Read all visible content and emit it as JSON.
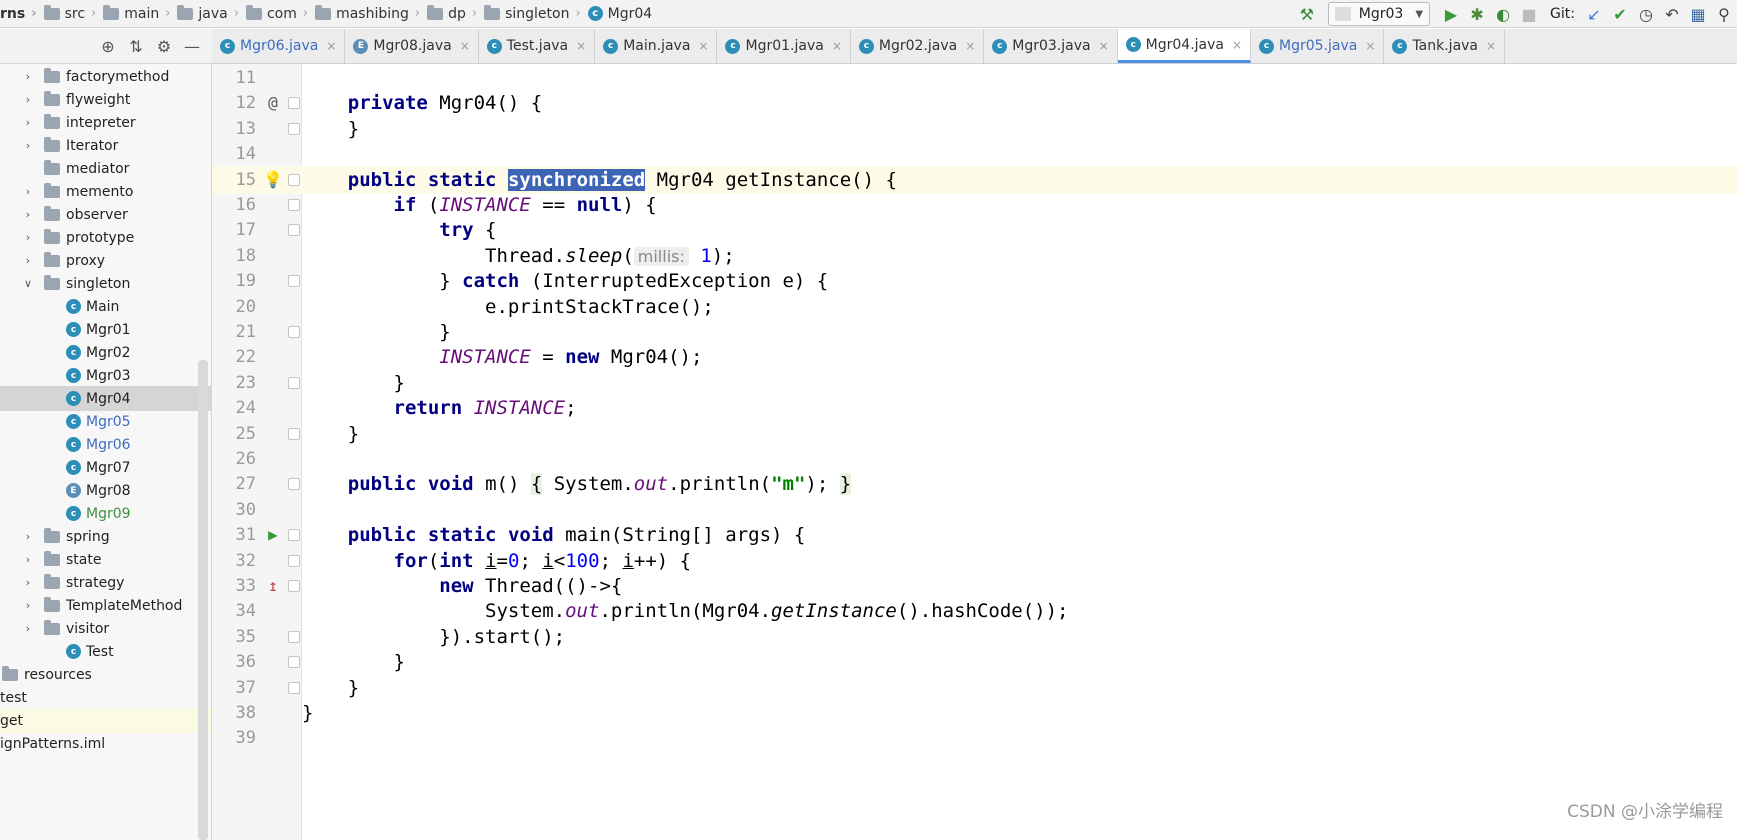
{
  "breadcrumbs": [
    "rns",
    "src",
    "main",
    "java",
    "com",
    "mashibing",
    "dp",
    "singleton",
    "Mgr04"
  ],
  "run_config": "Mgr03",
  "git_label": "Git:",
  "tabs": [
    {
      "label": "Mgr06.java",
      "modified": true,
      "active": false,
      "kind": "class"
    },
    {
      "label": "Mgr08.java",
      "modified": false,
      "active": false,
      "kind": "enum"
    },
    {
      "label": "Test.java",
      "modified": false,
      "active": false,
      "kind": "class"
    },
    {
      "label": "Main.java",
      "modified": false,
      "active": false,
      "kind": "class"
    },
    {
      "label": "Mgr01.java",
      "modified": false,
      "active": false,
      "kind": "class"
    },
    {
      "label": "Mgr02.java",
      "modified": false,
      "active": false,
      "kind": "class"
    },
    {
      "label": "Mgr03.java",
      "modified": false,
      "active": false,
      "kind": "class"
    },
    {
      "label": "Mgr04.java",
      "modified": false,
      "active": true,
      "kind": "class"
    },
    {
      "label": "Mgr05.java",
      "modified": true,
      "active": false,
      "kind": "class"
    },
    {
      "label": "Tank.java",
      "modified": false,
      "active": false,
      "kind": "class"
    }
  ],
  "tree": [
    {
      "label": "factorymethod",
      "type": "pkg",
      "expand": "closed",
      "indent": 1
    },
    {
      "label": "flyweight",
      "type": "pkg",
      "expand": "closed",
      "indent": 1
    },
    {
      "label": "intepreter",
      "type": "pkg",
      "expand": "closed",
      "indent": 1
    },
    {
      "label": "Iterator",
      "type": "pkg",
      "expand": "closed",
      "indent": 1
    },
    {
      "label": "mediator",
      "type": "pkg",
      "expand": "none",
      "indent": 1
    },
    {
      "label": "memento",
      "type": "pkg",
      "expand": "closed",
      "indent": 1
    },
    {
      "label": "observer",
      "type": "pkg",
      "expand": "closed",
      "indent": 1
    },
    {
      "label": "prototype",
      "type": "pkg",
      "expand": "closed",
      "indent": 1
    },
    {
      "label": "proxy",
      "type": "pkg",
      "expand": "closed",
      "indent": 1
    },
    {
      "label": "singleton",
      "type": "pkg",
      "expand": "open",
      "indent": 1
    },
    {
      "label": "Main",
      "type": "class",
      "indent": 2
    },
    {
      "label": "Mgr01",
      "type": "class",
      "indent": 2
    },
    {
      "label": "Mgr02",
      "type": "class",
      "indent": 2
    },
    {
      "label": "Mgr03",
      "type": "class",
      "indent": 2
    },
    {
      "label": "Mgr04",
      "type": "class",
      "indent": 2,
      "selected": true
    },
    {
      "label": "Mgr05",
      "type": "class",
      "indent": 2,
      "color": "blue"
    },
    {
      "label": "Mgr06",
      "type": "class",
      "indent": 2,
      "color": "blue"
    },
    {
      "label": "Mgr07",
      "type": "class",
      "indent": 2
    },
    {
      "label": "Mgr08",
      "type": "enum",
      "indent": 2
    },
    {
      "label": "Mgr09",
      "type": "class",
      "indent": 2,
      "color": "green"
    },
    {
      "label": "spring",
      "type": "pkg",
      "expand": "closed",
      "indent": 1
    },
    {
      "label": "state",
      "type": "pkg",
      "expand": "closed",
      "indent": 1
    },
    {
      "label": "strategy",
      "type": "pkg",
      "expand": "closed",
      "indent": 1
    },
    {
      "label": "TemplateMethod",
      "type": "pkg",
      "expand": "closed",
      "indent": 1
    },
    {
      "label": "visitor",
      "type": "pkg",
      "expand": "closed",
      "indent": 1
    },
    {
      "label": "Test",
      "type": "class",
      "indent": 2
    },
    {
      "label": "resources",
      "type": "pkg",
      "expand": "none",
      "indent": 0
    },
    {
      "label": "test",
      "type": "text",
      "indent": -1
    },
    {
      "label": "get",
      "type": "text",
      "indent": -1,
      "highlight": true
    },
    {
      "label": "ignPatterns.iml",
      "type": "text",
      "indent": -1
    }
  ],
  "code": {
    "line_numbers": [
      "11",
      "12",
      "13",
      "14",
      "15",
      "16",
      "17",
      "18",
      "19",
      "20",
      "21",
      "22",
      "23",
      "24",
      "25",
      "26",
      "27",
      "30",
      "31",
      "32",
      "33",
      "34",
      "35",
      "36",
      "37",
      "38",
      "39"
    ],
    "current_line": "15",
    "hint_label": "millis:",
    "t": {
      "private": "private",
      "public": "public",
      "static": "static",
      "synchronized": "synchronized",
      "void": "void",
      "if": "if",
      "try": "try",
      "catch": "catch",
      "new": "new",
      "return": "return",
      "null": "null",
      "for": "for",
      "int": "int",
      "mgr04_ctor": " Mgr04() {",
      "close": "}",
      "mgr04_sig": " Mgr04 getInstance() {",
      "l16a": " (",
      "instance": "INSTANCE",
      "l16b": " == ",
      "l16c": ") {",
      "l17": " {",
      "thread_sleep_a": "Thread.",
      "sleep": "sleep",
      "l18b": "(",
      "one": "1",
      "l18c": ");",
      "l19a": "} ",
      "l19b": " (InterruptedException e) {",
      "l20": "e.printStackTrace();",
      "l22a": " = ",
      "l22b": " Mgr04();",
      "l24": ";",
      "l27a": " m() ",
      "l27b": "{",
      "l27c": " System.",
      "out": "out",
      "l27d": ".println(",
      "str_m": "\"m\"",
      "l27e": "); ",
      "l27f": "}",
      "l31": " main(String[] args) {",
      "l32a": "(",
      "l32b": " ",
      "i": "i",
      "l32c": "=",
      "zero": "0",
      "l32d": "; ",
      "l32e": "<",
      "hundred": "100",
      "l32f": "; ",
      "l32g": "++) {",
      "l33": " Thread(()->{",
      "l34a": "System.",
      "l34b": ".println(Mgr04.",
      "getInstance": "getInstance",
      "l34c": "().hashCode());",
      "l35": "}).start();"
    }
  },
  "watermark": "CSDN @小涂学编程"
}
